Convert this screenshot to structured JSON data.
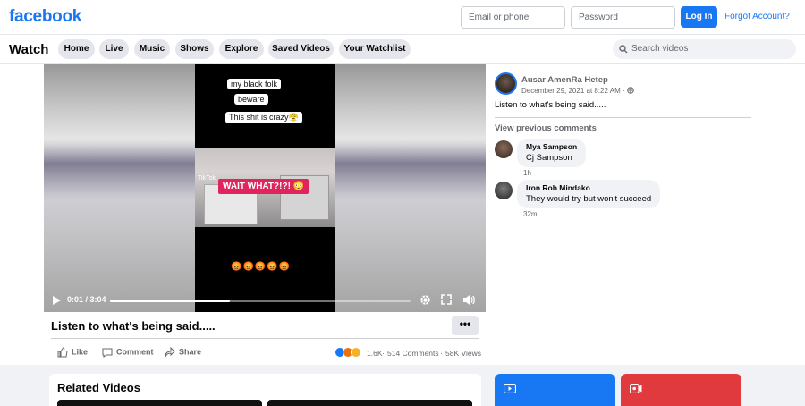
{
  "header": {
    "logo": "facebook",
    "email_placeholder": "Email or phone",
    "password_placeholder": "Password",
    "login_label": "Log In",
    "forgot_label": "Forgot Account?"
  },
  "watch_nav": {
    "title": "Watch",
    "tabs": [
      "Home",
      "Live",
      "Music",
      "Shows",
      "Explore",
      "Saved Videos",
      "Your Watchlist"
    ],
    "search_placeholder": "Search videos"
  },
  "video": {
    "captions": [
      "my black folk",
      "beware",
      "This shit is crazy😤"
    ],
    "overlay_text": "WAIT WHAT?!?! 😳",
    "tiktok_label": "TikTok",
    "emojis": "😡😡😡😡😡",
    "time": "0:01 / 3:04",
    "progress_fraction": 0.4
  },
  "post": {
    "title": "Listen to what's being said.....",
    "more_label": "•••",
    "actions": [
      "Like",
      "Comment",
      "Share"
    ],
    "reaction_count": "1.6K",
    "comments_count": "514 Comments",
    "views": "58K Views",
    "author": "Ausar AmenRa Hetep",
    "date": "December 29, 2021 at 8:22 AM ·",
    "text": "Listen to what's being said....."
  },
  "comments": {
    "view_previous": "View previous comments",
    "items": [
      {
        "name": "Mya Sampson",
        "text": "Cj Sampson",
        "time": "1h"
      },
      {
        "name": "Iron Rob Mindako",
        "text": "They would try but won't succeed",
        "time": "32m"
      }
    ]
  },
  "related": {
    "title": "Related Videos"
  },
  "colors": {
    "brand": "#1877f2",
    "live_red": "#e0393e"
  }
}
